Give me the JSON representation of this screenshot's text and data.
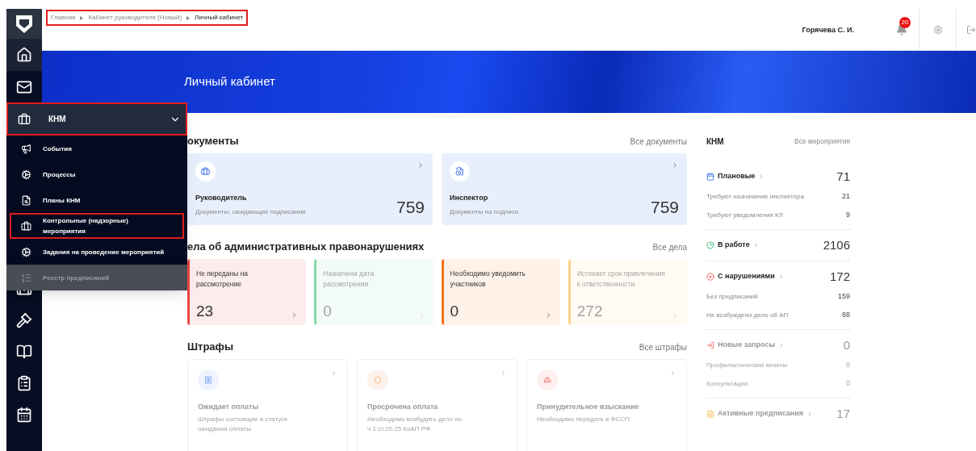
{
  "breadcrumbs": {
    "highlighted": true,
    "items": [
      {
        "label": "Главная",
        "current": false
      },
      {
        "label": "Кабинет руководителя (Новый)",
        "current": false
      },
      {
        "label": "Личный кабинет",
        "current": true
      }
    ]
  },
  "header": {
    "user": "Горячева С. И.",
    "notifications": "20"
  },
  "banner": {
    "title": "Личный кабинет"
  },
  "nav_menu": {
    "group": {
      "label": "КНМ",
      "expanded": true,
      "highlighted": true
    },
    "items": [
      {
        "label": "События",
        "highlighted": false,
        "disabled": false
      },
      {
        "label": "Процессы",
        "highlighted": false,
        "disabled": false
      },
      {
        "label": "Планы КНМ",
        "highlighted": false,
        "disabled": false
      },
      {
        "label": "Контрольные (надзорные) мероприятия",
        "highlighted": true,
        "disabled": false
      },
      {
        "label": "Задания на проведение мероприятий",
        "highlighted": false,
        "disabled": false
      },
      {
        "label": "Реестр предписаний",
        "highlighted": false,
        "disabled": true
      }
    ]
  },
  "documents": {
    "title": "окументы",
    "link": "Все документы",
    "cards": [
      {
        "title": "Руководитель",
        "subtitle": "Документы, ожидающие подписания",
        "count": "759"
      },
      {
        "title": "Инспектор",
        "subtitle": "Документы на подписи",
        "count": "759"
      }
    ]
  },
  "cases": {
    "title": "ела об административных правонарушениях",
    "link": "Все дела",
    "cards": [
      {
        "label": "Не переданы на рассмотрение",
        "count": "23",
        "color": "#ef4444",
        "disabled": false
      },
      {
        "label": "Назначена дата рассмотрения",
        "count": "0",
        "color": "#86d4a8",
        "disabled": true
      },
      {
        "label": "Необходимо уведомить участников",
        "count": "0",
        "color": "#f97316",
        "disabled": false
      },
      {
        "label": "Истекает срок привлечения к ответственности",
        "count": "272",
        "color": "#fcd38a",
        "disabled": true
      }
    ]
  },
  "fines": {
    "title": "Штрафы",
    "link": "Все штрафы",
    "cards": [
      {
        "title": "Ожидает оплаты",
        "subtitle": "Штрафы состоящие в статусе ожидания оплаты",
        "disabled": true
      },
      {
        "title": "Просрочена оплата",
        "subtitle": "Необходимо возбудить дело по ч.1 ст.20.25 КоАП РФ",
        "disabled": true
      },
      {
        "title": "Принудительное взыскание",
        "subtitle": "Необходимо передать в ФССП",
        "disabled": true
      }
    ]
  },
  "knm": {
    "title": "КНМ",
    "link": "Все мероприятия",
    "groups": [
      {
        "label": "Плановые",
        "count": "71",
        "disabled": false,
        "rows": [
          {
            "label": "Требуют назначение инспектора",
            "value": "21"
          },
          {
            "label": "Требуют уведомления КЛ",
            "value": "9"
          }
        ]
      },
      {
        "label": "В работе",
        "count": "2106",
        "disabled": false
      },
      {
        "label": "С нарушениями",
        "count": "172",
        "disabled": false,
        "rows": [
          {
            "label": "Без предписаний",
            "value": "159"
          },
          {
            "label": "Не возбуждено дело об АП",
            "value": "88"
          }
        ]
      },
      {
        "label": "Новые запросы",
        "count": "0",
        "disabled": true,
        "rows": [
          {
            "label": "Профилактические визиты",
            "value": "0"
          },
          {
            "label": "Консультации",
            "value": "0"
          }
        ]
      },
      {
        "label": "Активные предписания",
        "count": "17",
        "disabled": true
      }
    ]
  }
}
